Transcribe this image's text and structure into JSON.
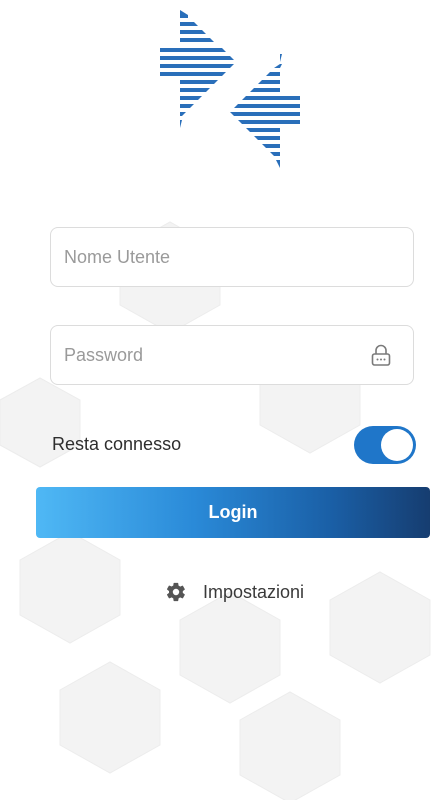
{
  "login_form": {
    "username_placeholder": "Nome Utente",
    "username_value": "",
    "password_placeholder": "Password",
    "password_value": "",
    "remember_label": "Resta connesso",
    "remember_on": true,
    "login_label": "Login",
    "settings_label": "Impostazioni"
  },
  "icons": {
    "logo": "brand-logo",
    "password": "lock-icon",
    "settings": "gear-icon"
  },
  "colors": {
    "logo_blue": "#2a6fba",
    "toggle_on": "#1f76c9",
    "button_gradient_start": "#4fb8f5",
    "button_gradient_end": "#163d70"
  }
}
